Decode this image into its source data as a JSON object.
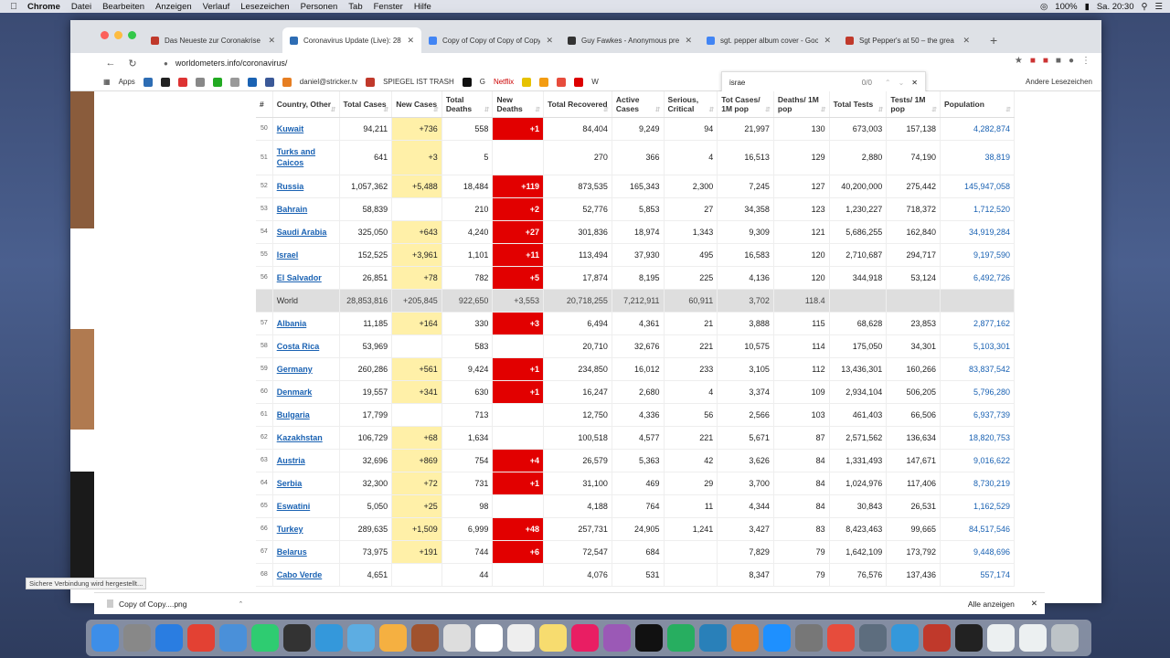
{
  "menubar": {
    "items": [
      "Chrome",
      "Datei",
      "Bearbeiten",
      "Anzeigen",
      "Verlauf",
      "Lesezeichen",
      "Personen",
      "Tab",
      "Fenster",
      "Hilfe"
    ],
    "battery": "100%",
    "clock": "Sa. 20:30"
  },
  "tabs": [
    {
      "title": "Das Neueste zur Coronakrise",
      "color": "#c0392b"
    },
    {
      "title": "Coronavirus Update (Live): 28",
      "color": "#2e6db4",
      "active": true
    },
    {
      "title": "Copy of Copy of Copy of Copy",
      "color": "#4285f4"
    },
    {
      "title": "Guy Fawkes - Anonymous pre",
      "color": "#333333"
    },
    {
      "title": "sgt. pepper album cover - Goo",
      "color": "#4285f4"
    },
    {
      "title": "Sgt Pepper's at 50 – the grea",
      "color": "#c0392b"
    }
  ],
  "omnibox": {
    "url": "worldometers.info/coronavirus/"
  },
  "bookmarks": {
    "apps": "Apps",
    "items": [
      "daniel@stricker.tv",
      "SPIEGEL IST TRASH",
      "G",
      "Netflix",
      "W"
    ],
    "other": "Andere Lesezeichen"
  },
  "find": {
    "query": "israe",
    "count": "0/0"
  },
  "table": {
    "headers": [
      "#",
      "Country, Other",
      "Total Cases",
      "New Cases",
      "Total Deaths",
      "New Deaths",
      "Total Recovered",
      "Active Cases",
      "Serious, Critical",
      "Tot Cases/ 1M pop",
      "Deaths/ 1M pop",
      "Total Tests",
      "Tests/ 1M pop",
      "Population"
    ],
    "rows": [
      {
        "rank": "50",
        "country": "Kuwait",
        "total": "94,211",
        "newc": "+736",
        "deaths": "558",
        "newd": "+1",
        "rec": "84,404",
        "active": "9,249",
        "serious": "94",
        "tot1m": "21,997",
        "d1m": "130",
        "tests": "673,003",
        "t1m": "157,138",
        "pop": "4,282,874"
      },
      {
        "rank": "51",
        "country": "Turks and Caicos",
        "total": "641",
        "newc": "+3",
        "deaths": "5",
        "newd": "",
        "rec": "270",
        "active": "366",
        "serious": "4",
        "tot1m": "16,513",
        "d1m": "129",
        "tests": "2,880",
        "t1m": "74,190",
        "pop": "38,819"
      },
      {
        "rank": "52",
        "country": "Russia",
        "total": "1,057,362",
        "newc": "+5,488",
        "deaths": "18,484",
        "newd": "+119",
        "rec": "873,535",
        "active": "165,343",
        "serious": "2,300",
        "tot1m": "7,245",
        "d1m": "127",
        "tests": "40,200,000",
        "t1m": "275,442",
        "pop": "145,947,058"
      },
      {
        "rank": "53",
        "country": "Bahrain",
        "total": "58,839",
        "newc": "",
        "deaths": "210",
        "newd": "+2",
        "rec": "52,776",
        "active": "5,853",
        "serious": "27",
        "tot1m": "34,358",
        "d1m": "123",
        "tests": "1,230,227",
        "t1m": "718,372",
        "pop": "1,712,520"
      },
      {
        "rank": "54",
        "country": "Saudi Arabia",
        "total": "325,050",
        "newc": "+643",
        "deaths": "4,240",
        "newd": "+27",
        "rec": "301,836",
        "active": "18,974",
        "serious": "1,343",
        "tot1m": "9,309",
        "d1m": "121",
        "tests": "5,686,255",
        "t1m": "162,840",
        "pop": "34,919,284"
      },
      {
        "rank": "55",
        "country": "Israel",
        "total": "152,525",
        "newc": "+3,961",
        "deaths": "1,101",
        "newd": "+11",
        "rec": "113,494",
        "active": "37,930",
        "serious": "495",
        "tot1m": "16,583",
        "d1m": "120",
        "tests": "2,710,687",
        "t1m": "294,717",
        "pop": "9,197,590"
      },
      {
        "rank": "56",
        "country": "El Salvador",
        "total": "26,851",
        "newc": "+78",
        "deaths": "782",
        "newd": "+5",
        "rec": "17,874",
        "active": "8,195",
        "serious": "225",
        "tot1m": "4,136",
        "d1m": "120",
        "tests": "344,918",
        "t1m": "53,124",
        "pop": "6,492,726"
      },
      {
        "rank": "",
        "country": "World",
        "total": "28,853,816",
        "newc": "+205,845",
        "deaths": "922,650",
        "newd": "+3,553",
        "rec": "20,718,255",
        "active": "7,212,911",
        "serious": "60,911",
        "tot1m": "3,702",
        "d1m": "118.4",
        "tests": "",
        "t1m": "",
        "pop": "",
        "world": true
      },
      {
        "rank": "57",
        "country": "Albania",
        "total": "11,185",
        "newc": "+164",
        "deaths": "330",
        "newd": "+3",
        "rec": "6,494",
        "active": "4,361",
        "serious": "21",
        "tot1m": "3,888",
        "d1m": "115",
        "tests": "68,628",
        "t1m": "23,853",
        "pop": "2,877,162"
      },
      {
        "rank": "58",
        "country": "Costa Rica",
        "total": "53,969",
        "newc": "",
        "deaths": "583",
        "newd": "",
        "rec": "20,710",
        "active": "32,676",
        "serious": "221",
        "tot1m": "10,575",
        "d1m": "114",
        "tests": "175,050",
        "t1m": "34,301",
        "pop": "5,103,301"
      },
      {
        "rank": "59",
        "country": "Germany",
        "total": "260,286",
        "newc": "+561",
        "deaths": "9,424",
        "newd": "+1",
        "rec": "234,850",
        "active": "16,012",
        "serious": "233",
        "tot1m": "3,105",
        "d1m": "112",
        "tests": "13,436,301",
        "t1m": "160,266",
        "pop": "83,837,542"
      },
      {
        "rank": "60",
        "country": "Denmark",
        "total": "19,557",
        "newc": "+341",
        "deaths": "630",
        "newd": "+1",
        "rec": "16,247",
        "active": "2,680",
        "serious": "4",
        "tot1m": "3,374",
        "d1m": "109",
        "tests": "2,934,104",
        "t1m": "506,205",
        "pop": "5,796,280"
      },
      {
        "rank": "61",
        "country": "Bulgaria",
        "total": "17,799",
        "newc": "",
        "deaths": "713",
        "newd": "",
        "rec": "12,750",
        "active": "4,336",
        "serious": "56",
        "tot1m": "2,566",
        "d1m": "103",
        "tests": "461,403",
        "t1m": "66,506",
        "pop": "6,937,739"
      },
      {
        "rank": "62",
        "country": "Kazakhstan",
        "total": "106,729",
        "newc": "+68",
        "deaths": "1,634",
        "newd": "",
        "rec": "100,518",
        "active": "4,577",
        "serious": "221",
        "tot1m": "5,671",
        "d1m": "87",
        "tests": "2,571,562",
        "t1m": "136,634",
        "pop": "18,820,753"
      },
      {
        "rank": "63",
        "country": "Austria",
        "total": "32,696",
        "newc": "+869",
        "deaths": "754",
        "newd": "+4",
        "rec": "26,579",
        "active": "5,363",
        "serious": "42",
        "tot1m": "3,626",
        "d1m": "84",
        "tests": "1,331,493",
        "t1m": "147,671",
        "pop": "9,016,622"
      },
      {
        "rank": "64",
        "country": "Serbia",
        "total": "32,300",
        "newc": "+72",
        "deaths": "731",
        "newd": "+1",
        "rec": "31,100",
        "active": "469",
        "serious": "29",
        "tot1m": "3,700",
        "d1m": "84",
        "tests": "1,024,976",
        "t1m": "117,406",
        "pop": "8,730,219"
      },
      {
        "rank": "65",
        "country": "Eswatini",
        "total": "5,050",
        "newc": "+25",
        "deaths": "98",
        "newd": "",
        "rec": "4,188",
        "active": "764",
        "serious": "11",
        "tot1m": "4,344",
        "d1m": "84",
        "tests": "30,843",
        "t1m": "26,531",
        "pop": "1,162,529"
      },
      {
        "rank": "66",
        "country": "Turkey",
        "total": "289,635",
        "newc": "+1,509",
        "deaths": "6,999",
        "newd": "+48",
        "rec": "257,731",
        "active": "24,905",
        "serious": "1,241",
        "tot1m": "3,427",
        "d1m": "83",
        "tests": "8,423,463",
        "t1m": "99,665",
        "pop": "84,517,546"
      },
      {
        "rank": "67",
        "country": "Belarus",
        "total": "73,975",
        "newc": "+191",
        "deaths": "744",
        "newd": "+6",
        "rec": "72,547",
        "active": "684",
        "serious": "",
        "tot1m": "7,829",
        "d1m": "79",
        "tests": "1,642,109",
        "t1m": "173,792",
        "pop": "9,448,696"
      },
      {
        "rank": "68",
        "country": "Cabo Verde",
        "total": "4,651",
        "newc": "",
        "deaths": "44",
        "newd": "",
        "rec": "4,076",
        "active": "531",
        "serious": "",
        "tot1m": "8,347",
        "d1m": "79",
        "tests": "76,576",
        "t1m": "137,436",
        "pop": "557,174"
      }
    ]
  },
  "status": "Sichere Verbindung wird hergestellt...",
  "downloads": {
    "file": "Copy of Copy....png",
    "show_all": "Alle anzeigen"
  }
}
